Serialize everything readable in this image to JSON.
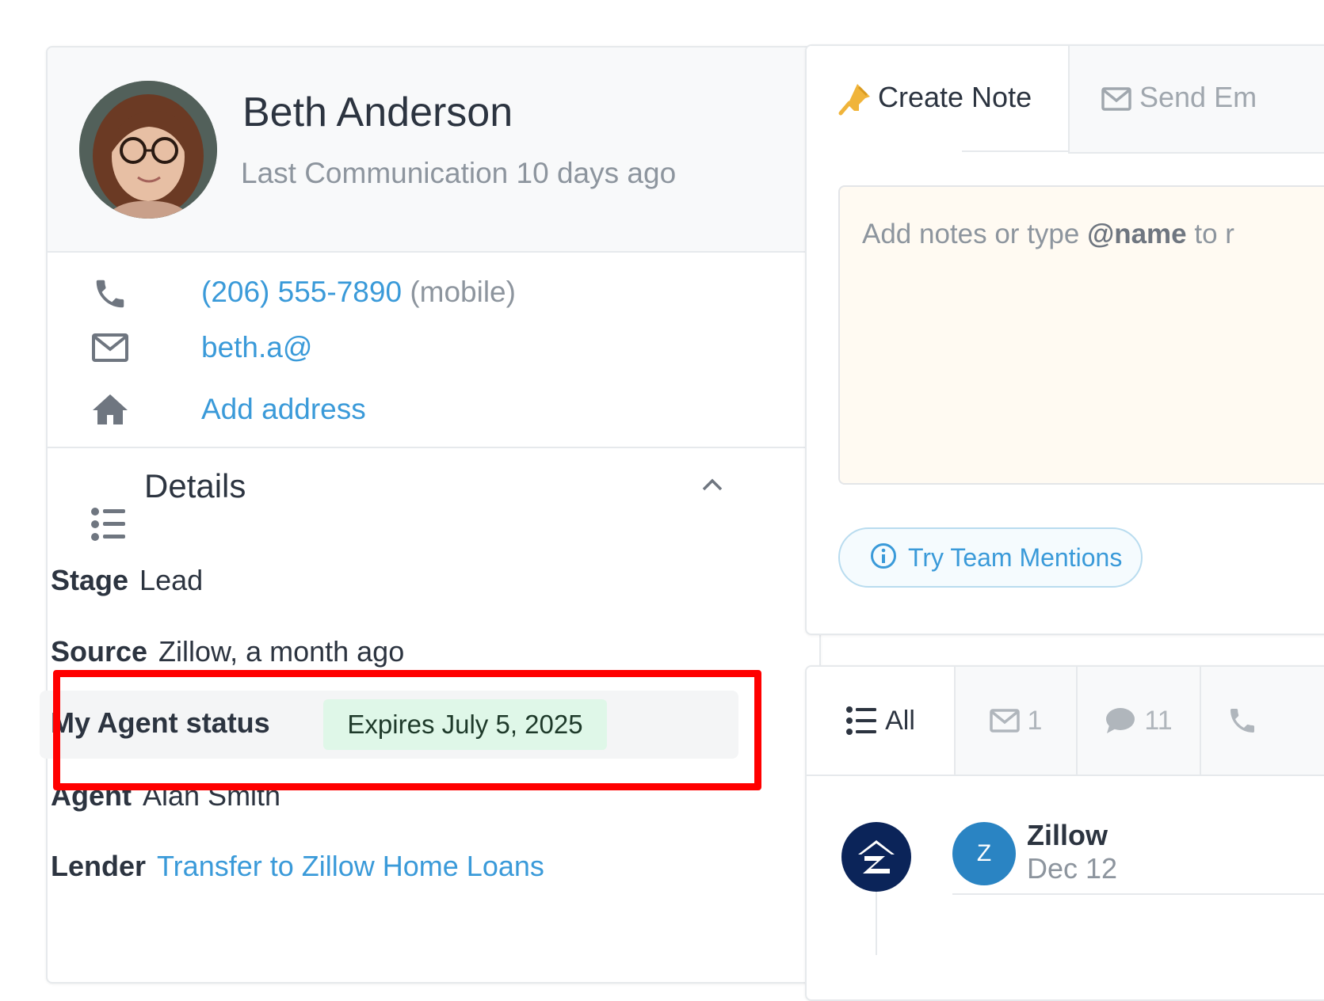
{
  "contact": {
    "name": "Beth Anderson",
    "last_communication": "Last Communication 10 days ago",
    "phone": "(206) 555-7890",
    "phone_type": "(mobile)",
    "email": "beth.a@",
    "address_action": "Add address"
  },
  "details": {
    "title": "Details",
    "stage_label": "Stage",
    "stage_value": "Lead",
    "source_label": "Source",
    "source_value": "Zillow, a month ago",
    "my_agent_status_label": "My Agent status",
    "my_agent_status_value": "Expires July 5, 2025",
    "agent_label": "Agent",
    "agent_value": "Alan Smith",
    "lender_label": "Lender",
    "lender_value": "Transfer to Zillow Home Loans"
  },
  "note": {
    "tab_create": "Create Note",
    "tab_send": "Send Em",
    "placeholder_prefix": "Add notes or type ",
    "placeholder_bold": "@name",
    "placeholder_suffix": " to r",
    "mentions_button": "Try Team Mentions"
  },
  "activity": {
    "tab_all": "All",
    "email_count": "1",
    "message_count": "11",
    "items": [
      {
        "avatar_letter": "Z",
        "title": "Zillow",
        "date": "Dec 12"
      }
    ]
  },
  "colors": {
    "link": "#3a9ad9",
    "highlight": "#ff0000",
    "badge_bg": "#dff7e8",
    "zillow_navy": "#0b2459",
    "avatar_blue": "#2a84c3"
  }
}
